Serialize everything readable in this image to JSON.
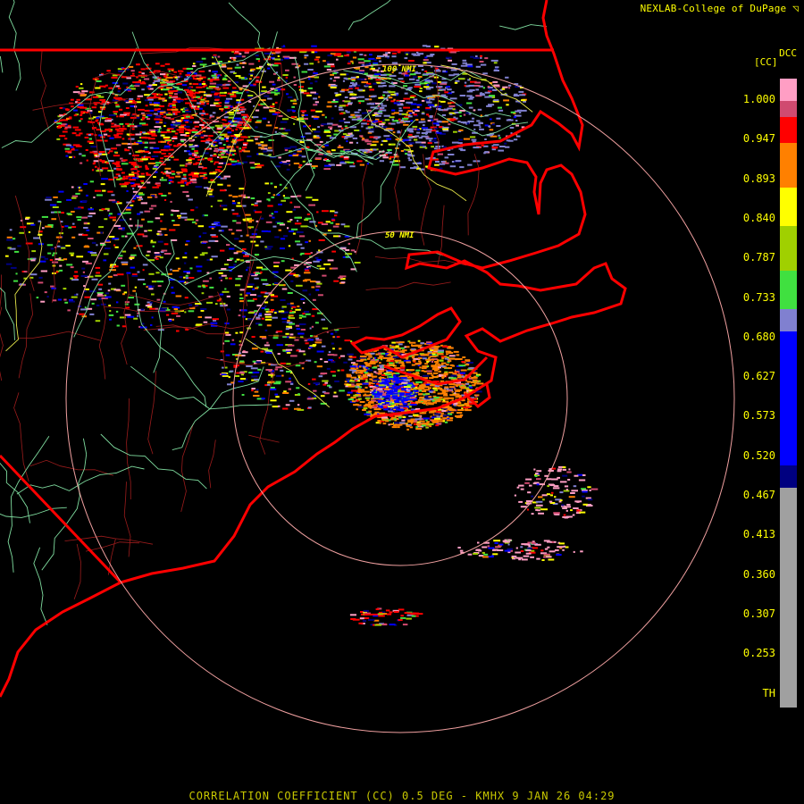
{
  "header": {
    "credit": "NEXLAB-College of DuPage",
    "credit_icon": "corner-logo-icon",
    "product_code": "DCC",
    "unit_label": "[CC]"
  },
  "map": {
    "range_rings": [
      {
        "label": "100 NMI"
      },
      {
        "label": "50 NMI"
      }
    ],
    "colors": {
      "state_border": "#ff0000",
      "county_lines": "#9b1c1c",
      "highways": "#7fdc9f",
      "interstates": "#e8e84a",
      "range_ring": "#f0a0a0"
    }
  },
  "colorbar": {
    "ticks": [
      "1.000",
      "0.947",
      "0.893",
      "0.840",
      "0.787",
      "0.733",
      "0.680",
      "0.627",
      "0.573",
      "0.520",
      "0.467",
      "0.413",
      "0.360",
      "0.307",
      "0.253",
      "TH"
    ],
    "colors": [
      "#ff9ec4",
      "#d04a70",
      "#ff0000",
      "#ff8000",
      "#ffff00",
      "#a0d000",
      "#40e040",
      "#8080d0",
      "#0000ff",
      "#000080",
      "#a0a0a0",
      "#000000"
    ]
  },
  "footer": {
    "text": "CORRELATION COEFFICIENT (CC) 0.5 DEG - KMHX 9 JAN 26 04:29"
  }
}
